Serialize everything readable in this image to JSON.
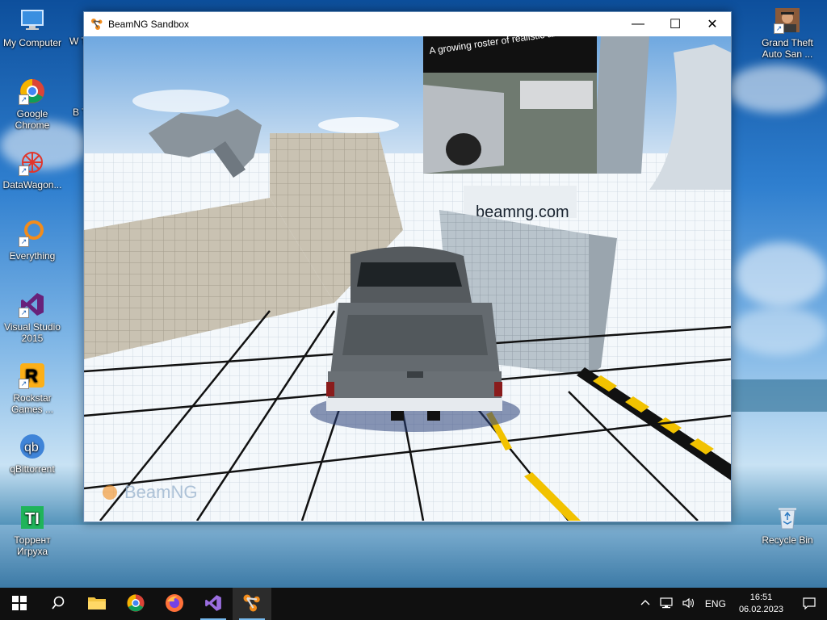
{
  "desktop": {
    "left_icons": [
      {
        "label": "My Computer",
        "icon": "computer-icon"
      },
      {
        "label": "Google Chrome",
        "icon": "chrome-icon"
      },
      {
        "label": "DataWagon...",
        "icon": "datawagon-icon"
      },
      {
        "label": "Everything",
        "icon": "everything-icon"
      },
      {
        "label": "Visual Studio 2015",
        "icon": "visual-studio-icon"
      },
      {
        "label": "Rockstar Games ...",
        "icon": "rockstar-icon"
      },
      {
        "label": "qBittorrent",
        "icon": "qbittorrent-icon"
      },
      {
        "label": "Торрент Игруха",
        "icon": "torrent-igruha-icon"
      }
    ],
    "right_icons": [
      {
        "label": "Grand Theft Auto San ...",
        "icon": "gta-icon"
      },
      {
        "label": "Recycle Bin",
        "icon": "recycle-bin-icon"
      }
    ],
    "partial_icons": [
      "W T",
      "B T"
    ]
  },
  "window": {
    "title": "BeamNG Sandbox",
    "controls": {
      "minimize": "—",
      "maximize": "☐",
      "close": "✕"
    }
  },
  "scene": {
    "billboard_text": "A growing roster of realistic and varied handling",
    "pedestal_text": "beamng.com",
    "watermark": "BeamNG"
  },
  "taskbar": {
    "items": [
      {
        "name": "start",
        "icon": "windows-logo-icon"
      },
      {
        "name": "search",
        "icon": "search-icon"
      },
      {
        "name": "file-explorer",
        "icon": "folder-icon"
      },
      {
        "name": "chrome",
        "icon": "chrome-icon"
      },
      {
        "name": "firefox",
        "icon": "firefox-icon"
      },
      {
        "name": "visual-studio",
        "icon": "visual-studio-icon"
      },
      {
        "name": "beamng",
        "icon": "beamng-icon"
      }
    ],
    "tray": {
      "language": "ENG",
      "time": "16:51",
      "date": "06.02.2023"
    }
  }
}
